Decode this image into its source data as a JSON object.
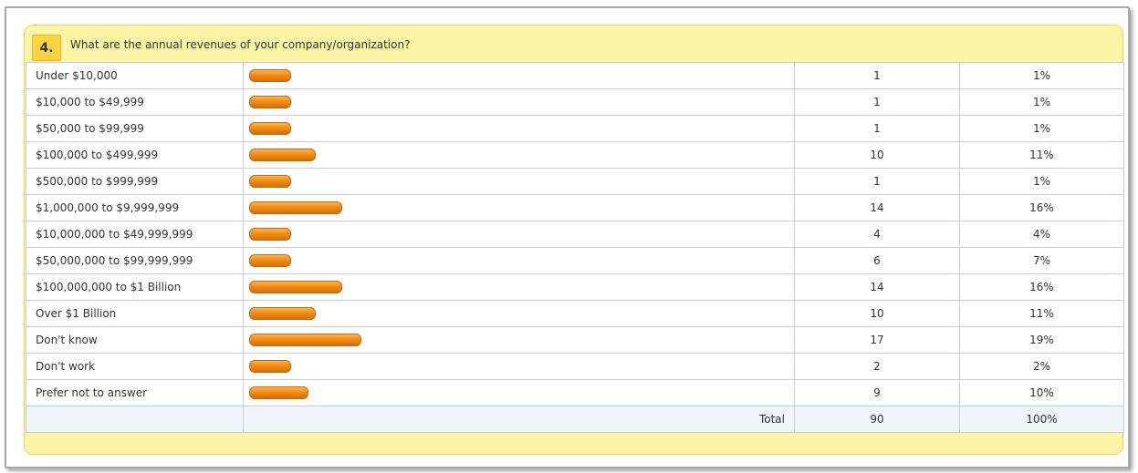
{
  "question": {
    "number": "4.",
    "text": "What are the annual revenues of your company/organization?"
  },
  "colors": {
    "bar": "#f28d14",
    "card_bg": "#fdf5a6",
    "number_badge": "#fcd340"
  },
  "chart_data": {
    "type": "bar",
    "title": "What are the annual revenues of your company/organization?",
    "categories": [
      "Under $10,000",
      "$10,000 to $49,999",
      "$50,000 to $99,999",
      "$100,000 to $499,999",
      "$500,000 to $999,999",
      "$1,000,000 to $9,999,999",
      "$10,000,000 to $49,999,999",
      "$50,000,000 to $99,999,999",
      "$100,000,000 to $1 Billion",
      "Over $1 Billion",
      "Don't know",
      "Don't work",
      "Prefer not to answer"
    ],
    "counts": [
      "1",
      "1",
      "1",
      "10",
      "1",
      "14",
      "4",
      "6",
      "14",
      "10",
      "17",
      "2",
      "9"
    ],
    "percents": [
      "1%",
      "1%",
      "1%",
      "11%",
      "1%",
      "16%",
      "4%",
      "7%",
      "16%",
      "11%",
      "19%",
      "2%",
      "10%"
    ],
    "values": [
      1,
      1,
      1,
      10,
      1,
      14,
      4,
      6,
      14,
      10,
      17,
      2,
      9
    ],
    "total_label": "Total",
    "total_count": "90",
    "total_percent": "100%"
  }
}
